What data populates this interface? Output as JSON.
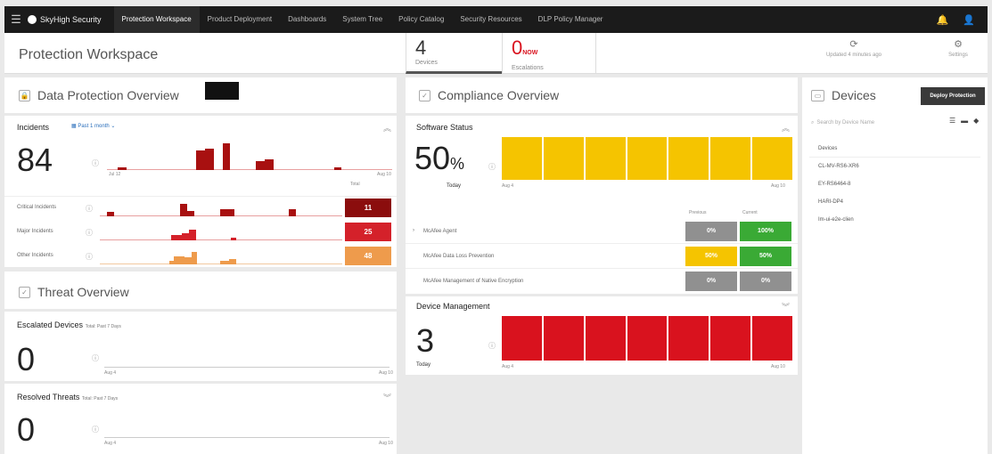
{
  "topnav": {
    "brand": "SkyHigh Security",
    "items": [
      "Protection Workspace",
      "Product Deployment",
      "Dashboards",
      "System Tree",
      "Policy Catalog",
      "Security Resources",
      "DLP Policy Manager"
    ],
    "active": 0
  },
  "header": {
    "title": "Protection Workspace",
    "devices": {
      "value": "4",
      "label": "Devices"
    },
    "escalations": {
      "value": "0",
      "suffix": "NOW",
      "label": "Escalations"
    },
    "updated": "Updated 4 minutes ago",
    "settings": "Settings"
  },
  "data_protection": {
    "title": "Data Protection Overview",
    "incidents": {
      "label": "Incidents",
      "period": "Past 1 month",
      "value": "84",
      "x_start": "Jul 12",
      "x_end": "Aug 10",
      "total_label": "Total",
      "rows": [
        {
          "label": "Critical Incidents",
          "total": "11",
          "color": "#8b0d0d"
        },
        {
          "label": "Major Incidents",
          "total": "25",
          "color": "#d4212a"
        },
        {
          "label": "Other Incidents",
          "total": "48",
          "color": "#ee9b4c"
        }
      ]
    }
  },
  "threat": {
    "title": "Threat Overview",
    "escalated": {
      "label": "Escalated Devices",
      "sub": "Total: Past 7 Days",
      "value": "0",
      "x_start": "Aug 4",
      "x_end": "Aug 10"
    },
    "resolved": {
      "label": "Resolved Threats",
      "sub": "Total: Past 7 Days",
      "value": "0",
      "x_start": "Aug 4",
      "x_end": "Aug 10"
    }
  },
  "compliance": {
    "title": "Compliance Overview",
    "software": {
      "label": "Software Status",
      "value": "50",
      "unit": "%",
      "today": "Today",
      "x_start": "Aug 4",
      "x_end": "Aug 10",
      "col_prev": "Previous",
      "col_curr": "Current",
      "rows": [
        {
          "label": "McAfee Agent",
          "prev": "0%",
          "curr": "100%"
        },
        {
          "label": "McAfee Data Loss Prevention",
          "prev": "50%",
          "curr": "50%"
        },
        {
          "label": "McAfee Management of Native Encryption",
          "prev": "0%",
          "curr": "0%"
        }
      ]
    },
    "device_mgmt": {
      "label": "Device Management",
      "value": "3",
      "today": "Today",
      "x_start": "Aug 4",
      "x_end": "Aug 10"
    }
  },
  "devices": {
    "title": "Devices",
    "deploy_label": "Deploy Protection",
    "search_placeholder": "Search by Device Name",
    "col": "Devices",
    "list": [
      "CL-MV-RS6-XR6",
      "EY-RS6464-8",
      "HARI-DP4",
      "Im-ui-e2e-clien"
    ]
  },
  "colors": {
    "critical": "#8b0d0d",
    "major": "#d4212a",
    "other": "#ee9b4c",
    "yellow": "#f5c400",
    "green": "#3aaa35",
    "gray": "#909090",
    "red": "#d9121e"
  },
  "chart_data": [
    {
      "type": "bar",
      "title": "Incidents",
      "x": [
        "Jul 12",
        "Aug 10"
      ],
      "series": [
        {
          "name": "Critical Incidents",
          "total": 11
        },
        {
          "name": "Major Incidents",
          "total": 25
        },
        {
          "name": "Other Incidents",
          "total": 48
        }
      ]
    },
    {
      "type": "bar",
      "title": "Software Status",
      "x": [
        "Aug 4",
        "Aug 10"
      ],
      "values": [
        50,
        50,
        50,
        50,
        50,
        50,
        50
      ]
    },
    {
      "type": "bar",
      "title": "Device Management",
      "x": [
        "Aug 4",
        "Aug 10"
      ],
      "values": [
        3,
        3,
        3,
        3,
        3,
        3,
        3
      ]
    }
  ]
}
